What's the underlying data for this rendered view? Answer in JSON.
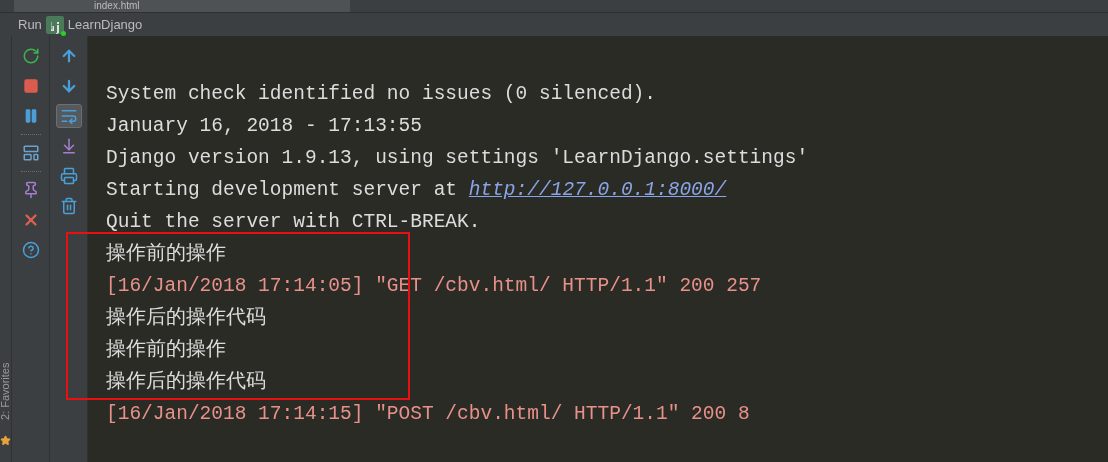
{
  "editor_tab": {
    "label": "index.html"
  },
  "run_panel": {
    "title": "Run",
    "config": "LearnDjango",
    "soft_wrap_on": true
  },
  "console": {
    "lines": [
      {
        "kind": "plain",
        "text": "System check identified no issues (0 silenced)."
      },
      {
        "kind": "plain",
        "text": "January 16, 2018 - 17:13:55"
      },
      {
        "kind": "plain",
        "text": "Django version 1.9.13, using settings 'LearnDjango.settings'"
      },
      {
        "kind": "link",
        "text": "Starting development server at ",
        "link": "http://127.0.0.1:8000/"
      },
      {
        "kind": "plain",
        "text": "Quit the server with CTRL-BREAK."
      },
      {
        "kind": "plain",
        "text": "操作前的操作"
      },
      {
        "kind": "error",
        "text": "[16/Jan/2018 17:14:05] \"GET /cbv.html/ HTTP/1.1\" 200 257"
      },
      {
        "kind": "plain",
        "text": "操作后的操作代码"
      },
      {
        "kind": "plain",
        "text": "操作前的操作"
      },
      {
        "kind": "plain",
        "text": "操作后的操作代码"
      },
      {
        "kind": "error",
        "text": "[16/Jan/2018 17:14:15] \"POST /cbv.html/ HTTP/1.1\" 200 8"
      }
    ]
  },
  "side_stripe": {
    "label": "2: Favorites"
  }
}
